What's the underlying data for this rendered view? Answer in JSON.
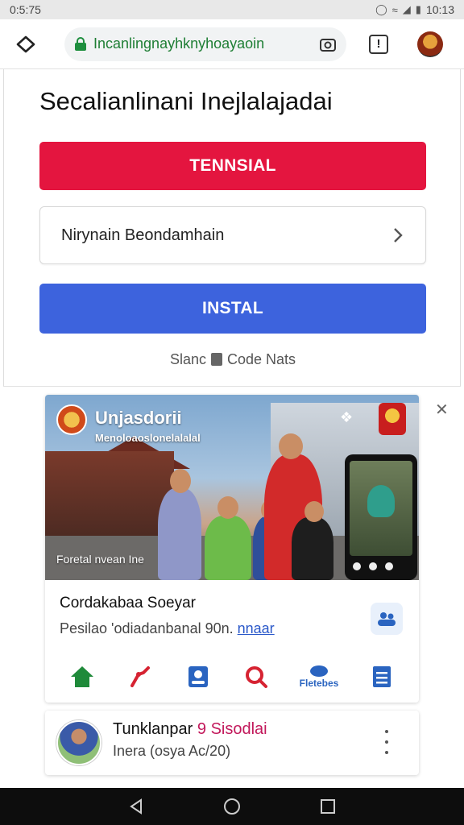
{
  "status_bar": {
    "time": "0:5:75",
    "clock": "10:13"
  },
  "browser": {
    "url": "Incanlingnayhknyhoayaoin"
  },
  "page": {
    "title": "Secalianlinani Inejlalajadai",
    "primary_button": "TENNSIAL",
    "select_label": "Nirynain Beondamhain",
    "install_button": "INSTAL",
    "sub_text_a": "Slanc",
    "sub_text_b": "Code Nats"
  },
  "ad": {
    "overlay_title": "Unjasdorii",
    "overlay_subtitle": "Menoloaoslonelalalal",
    "overlay_footer": "Foretal nvean Ine",
    "headline": "Cordakabaa Soeyar",
    "description": "Pesilao 'odiadanbanal 90n.",
    "description_link": "nnaar",
    "icons": [
      {
        "name": "home",
        "label": ""
      },
      {
        "name": "share",
        "label": ""
      },
      {
        "name": "contact",
        "label": ""
      },
      {
        "name": "search",
        "label": ""
      },
      {
        "name": "feedback",
        "label": "Fletebes"
      },
      {
        "name": "list",
        "label": ""
      }
    ]
  },
  "profile": {
    "name": "Tunklanpar",
    "tag": "9 Sisodlai",
    "meta": "Inera (osya Ac/20)"
  },
  "colors": {
    "primary_red": "#e4153f",
    "primary_blue": "#3d63dd",
    "url_green": "#1e7e34"
  }
}
